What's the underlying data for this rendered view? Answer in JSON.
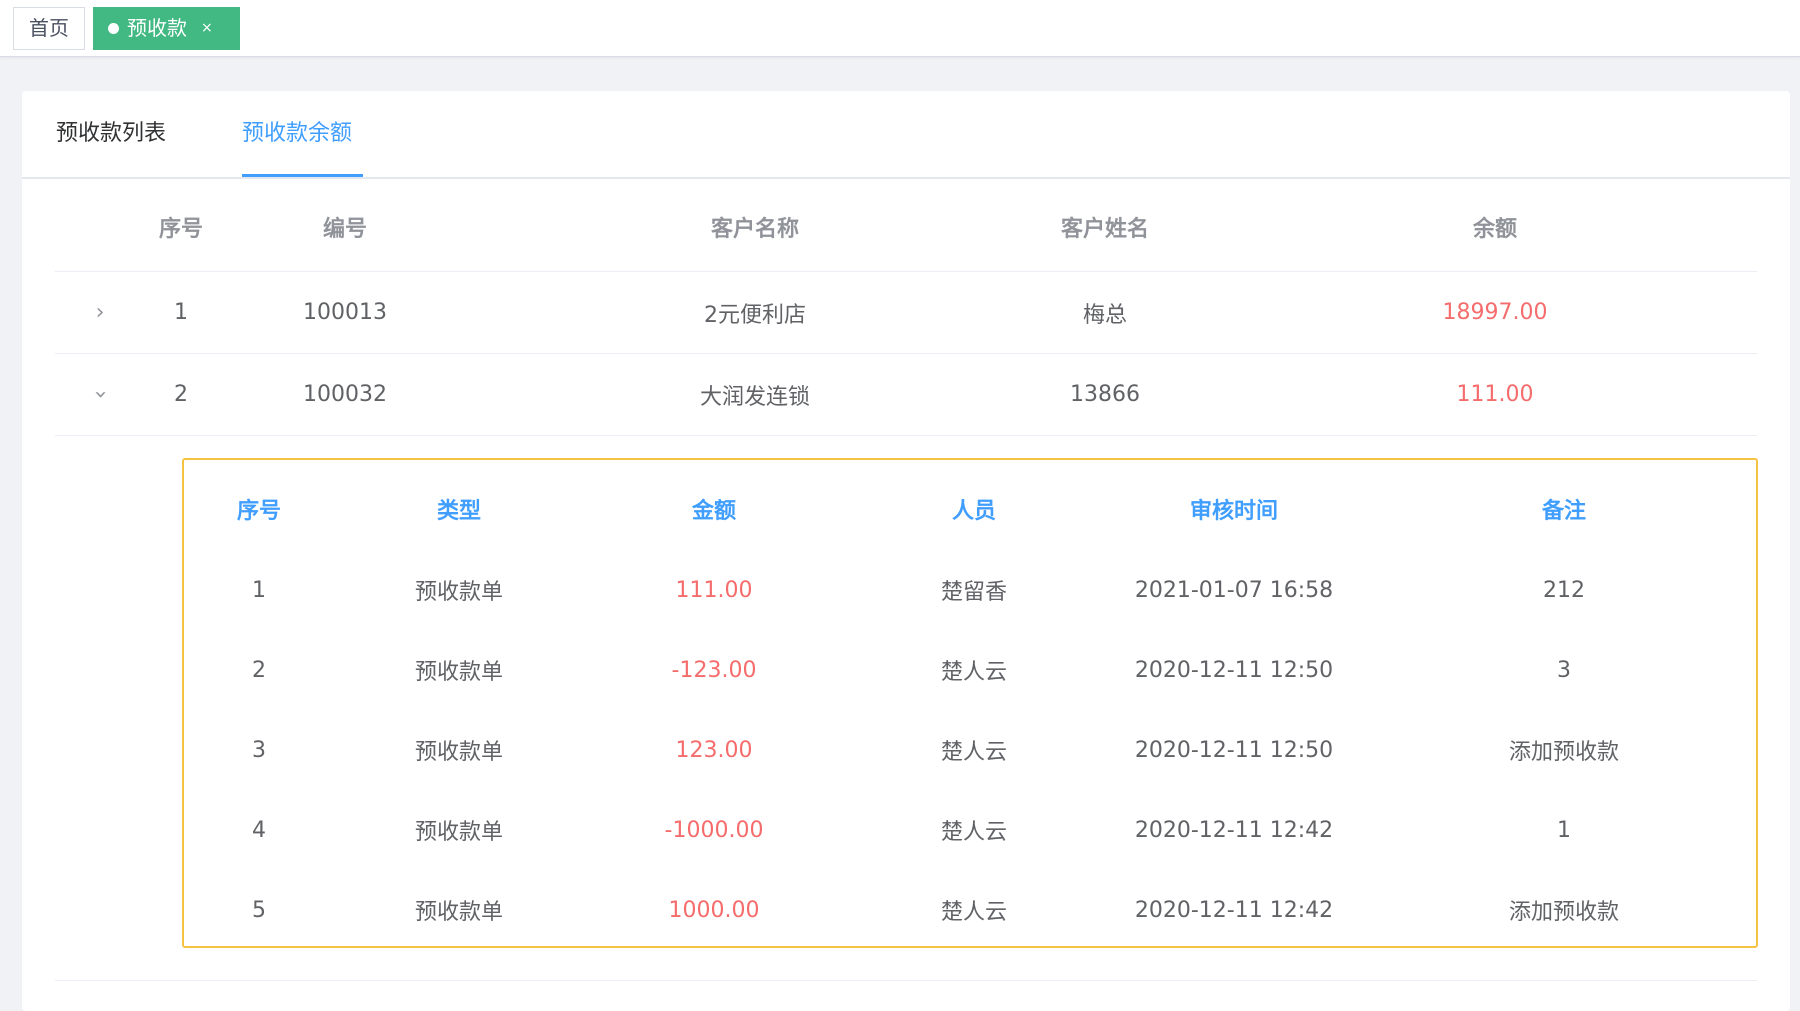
{
  "tags": {
    "home": "首页",
    "active": "预收款",
    "close": "×"
  },
  "tabs": [
    "预收款列表",
    "预收款余额"
  ],
  "table": {
    "headers": [
      "序号",
      "编号",
      "客户名称",
      "客户姓名",
      "余额"
    ],
    "rows": [
      {
        "index": "1",
        "code": "100013",
        "customer_name": "2元便利店",
        "person": "梅总",
        "balance": "18997.00",
        "expanded": false
      },
      {
        "index": "2",
        "code": "100032",
        "customer_name": "大润发连锁",
        "person": "13866",
        "balance": "111.00",
        "expanded": true
      }
    ]
  },
  "detail": {
    "headers": [
      "序号",
      "类型",
      "金额",
      "人员",
      "审核时间",
      "备注"
    ],
    "rows": [
      {
        "index": "1",
        "type": "预收款单",
        "amount": "111.00",
        "user": "楚留香",
        "time": "2021-01-07 16:58",
        "note": "212"
      },
      {
        "index": "2",
        "type": "预收款单",
        "amount": "-123.00",
        "user": "楚人云",
        "time": "2020-12-11 12:50",
        "note": "3"
      },
      {
        "index": "3",
        "type": "预收款单",
        "amount": "123.00",
        "user": "楚人云",
        "time": "2020-12-11 12:50",
        "note": "添加预收款"
      },
      {
        "index": "4",
        "type": "预收款单",
        "amount": "-1000.00",
        "user": "楚人云",
        "time": "2020-12-11 12:42",
        "note": "1"
      },
      {
        "index": "5",
        "type": "预收款单",
        "amount": "1000.00",
        "user": "楚人云",
        "time": "2020-12-11 12:42",
        "note": "添加预收款"
      }
    ]
  },
  "colors": {
    "accent": "#409eff",
    "tag_active": "#42b983",
    "amount": "#f56c6c",
    "detail_border": "#f5c242"
  },
  "icons": {
    "collapsed": "chevron-right-icon",
    "expanded": "chevron-down-icon"
  }
}
